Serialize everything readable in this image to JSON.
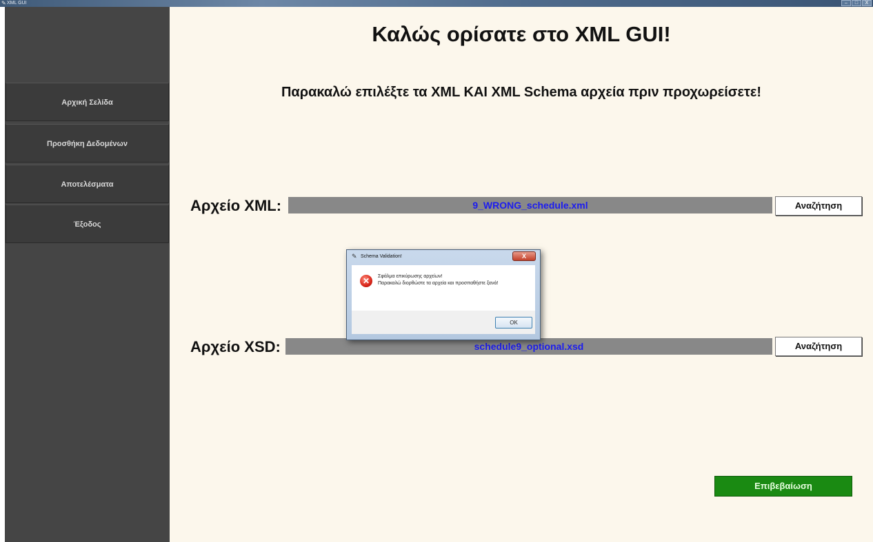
{
  "window": {
    "title": "XML GUI",
    "controls": [
      "–",
      "□",
      "X"
    ]
  },
  "sidebar": {
    "items": [
      {
        "label": "Αρχική Σελίδα"
      },
      {
        "label": "Προσθήκη Δεδομένων"
      },
      {
        "label": "Αποτελέσματα"
      },
      {
        "label": "Έξοδος"
      }
    ]
  },
  "main": {
    "welcome": "Καλώς ορίσατε στο XML GUI!",
    "instruction": "Παρακαλώ επιλέξτε τα XML ΚΑΙ XML Schema αρχεία πριν προχωρείσετε!",
    "xml": {
      "label": "Αρχείο XML:",
      "value": "9_WRONG_schedule.xml",
      "browse": "Αναζήτηση"
    },
    "xsd": {
      "label": "Αρχείο XSD:",
      "value": "schedule9_optional.xsd",
      "browse": "Αναζήτηση"
    },
    "confirm": "Επιβεβαίωση"
  },
  "dialog": {
    "title": "Schema Validation!",
    "close": "X",
    "line1": "Σφάλμα επικύρωσης αρχείων!",
    "line2": "Παρακαλώ διορθώστε τα αρχεία και προσπαθήστε ξανά!",
    "ok": "OK",
    "icon": "error-icon"
  },
  "colors": {
    "sidebar": "#454545",
    "main_bg": "#fcf7ec",
    "field_bg": "#888888",
    "field_text": "#1c1cf0",
    "confirm_bg": "#1a8a12"
  }
}
